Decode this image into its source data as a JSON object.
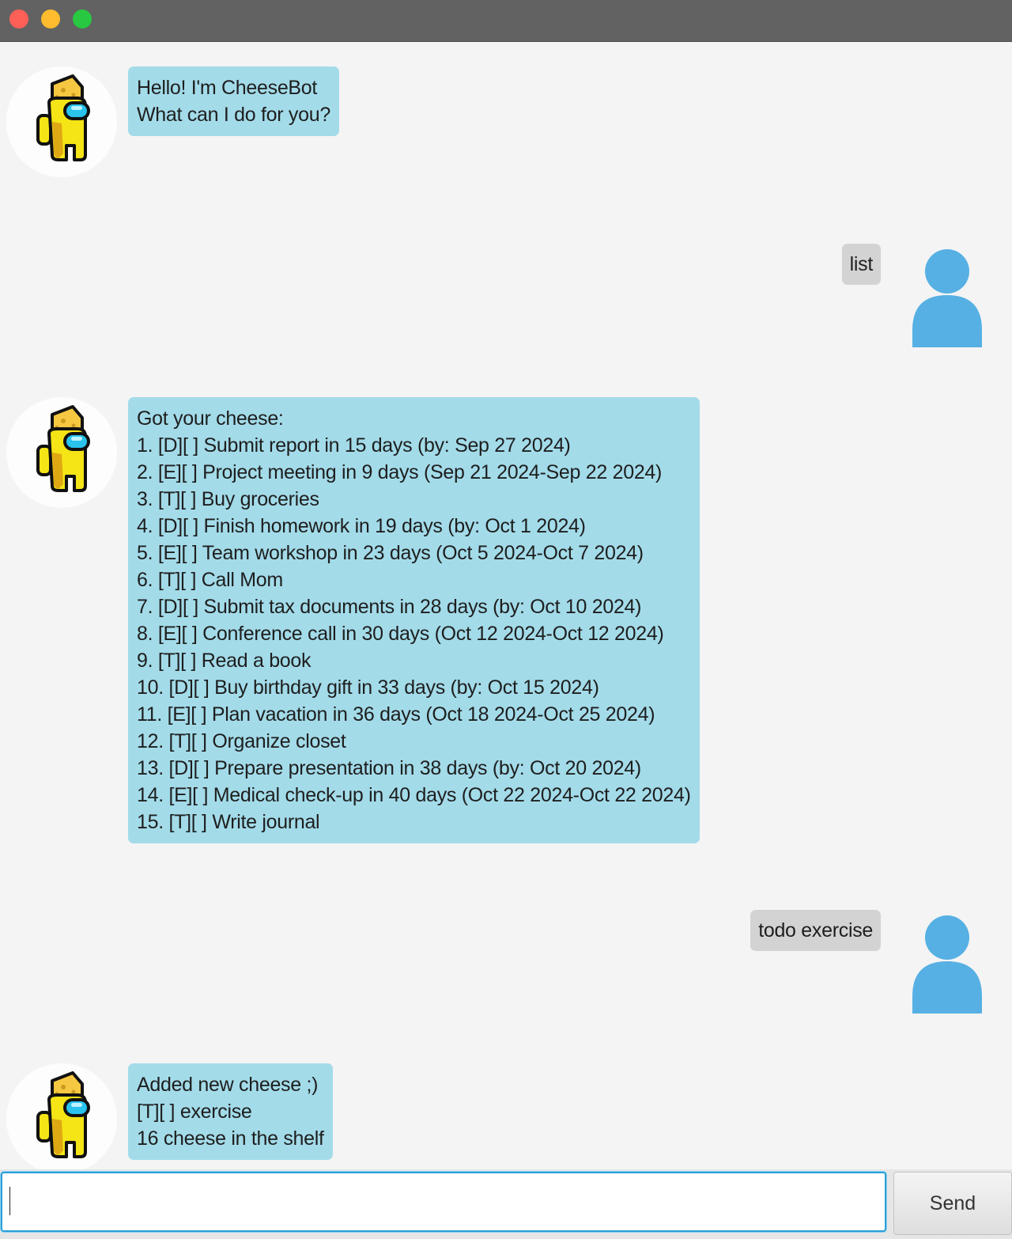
{
  "window": {
    "title": ""
  },
  "chat": {
    "messages": [
      {
        "sender": "bot",
        "lines": [
          "Hello! I'm CheeseBot",
          "What can I do for you?"
        ]
      },
      {
        "sender": "user",
        "lines": [
          "list"
        ]
      },
      {
        "sender": "bot",
        "lines": [
          "Got your cheese:",
          "1. [D][ ] Submit report in 15 days (by: Sep 27 2024)",
          "2. [E][ ] Project meeting in 9 days (Sep 21 2024-Sep 22 2024)",
          "3. [T][ ] Buy groceries",
          "4. [D][ ] Finish homework in 19 days (by: Oct 1 2024)",
          "5. [E][ ] Team workshop in 23 days (Oct 5 2024-Oct 7 2024)",
          "6. [T][ ] Call Mom",
          "7. [D][ ] Submit tax documents in 28 days (by: Oct 10 2024)",
          "8. [E][ ] Conference call in 30 days (Oct 12 2024-Oct 12 2024)",
          "9. [T][ ] Read a book",
          "10. [D][ ] Buy birthday gift in 33 days (by: Oct 15 2024)",
          "11. [E][ ] Plan vacation in 36 days (Oct 18 2024-Oct 25 2024)",
          "12. [T][ ] Organize closet",
          "13. [D][ ] Prepare presentation in 38 days (by: Oct 20 2024)",
          "14. [E][ ] Medical check-up in 40 days (Oct 22 2024-Oct 22 2024)",
          "15. [T][ ] Write journal"
        ]
      },
      {
        "sender": "user",
        "lines": [
          "todo exercise"
        ]
      },
      {
        "sender": "bot",
        "lines": [
          "Added new cheese ;)",
          "[T][ ] exercise",
          "16 cheese in the shelf"
        ]
      }
    ]
  },
  "input": {
    "value": "",
    "placeholder": ""
  },
  "send_button": {
    "label": "Send"
  },
  "icons": {
    "bot_avatar": "crewmate-cheese-icon",
    "user_avatar": "user-silhouette-icon"
  },
  "colors": {
    "bot_bubble": "#a3dbe9",
    "user_bubble": "#d3d3d3",
    "user_avatar": "#56b0e4",
    "crewmate_body": "#f5e416",
    "crewmate_visor": "#29c3ee",
    "input_focus": "#2a9fd8",
    "titlebar": "#626262"
  }
}
